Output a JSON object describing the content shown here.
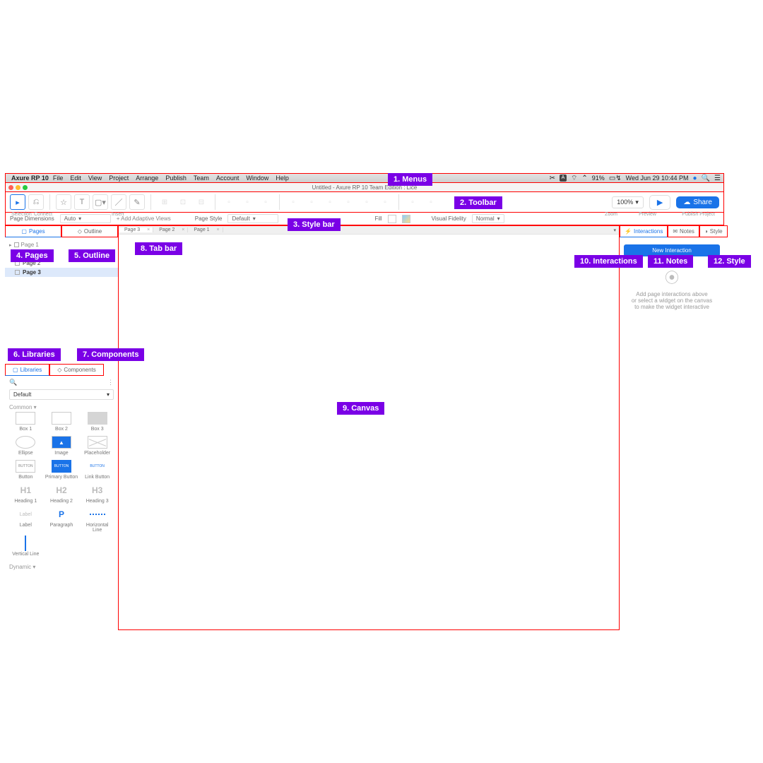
{
  "menubar": {
    "app": "Axure RP 10",
    "items": [
      "File",
      "Edit",
      "View",
      "Project",
      "Arrange",
      "Publish",
      "Team",
      "Account",
      "Window",
      "Help"
    ],
    "battery": "91%",
    "datetime": "Wed Jun 29  10:44 PM"
  },
  "titlebar": {
    "title": "Untitled - Axure RP 10 Team Edition : Lice"
  },
  "toolbar": {
    "selection_lbl": "Selection",
    "connect_lbl": "Connect",
    "insert_lbl": "Insert",
    "zoom_val": "100%",
    "zoom_lbl": "Zoom",
    "preview_lbl": "Preview",
    "share": "Share",
    "publish_lbl": "Publish Project"
  },
  "stylebar": {
    "dims_lbl": "Page Dimensions",
    "dims_val": "Auto",
    "adaptive": "+ Add Adaptive Views",
    "pagestyle_lbl": "Page Style",
    "pagestyle_val": "Default",
    "fill_lbl": "Fill",
    "visual_lbl": "Visual Fidelity",
    "visual_val": "Normal"
  },
  "left": {
    "pages_tab": "Pages",
    "outline_tab": "Outline",
    "pages_hdr": "Page 1",
    "pages": [
      "Page 1",
      "Page 2",
      "Page 3"
    ],
    "selected": "Page 3",
    "lib_tab": "Libraries",
    "comp_tab": "Components",
    "lib_select": "Default",
    "cat_common": "Common",
    "cat_dynamic": "Dynamic",
    "widgets": [
      {
        "n": "Box 1",
        "k": "box"
      },
      {
        "n": "Box 2",
        "k": "box"
      },
      {
        "n": "Box 3",
        "k": "filled"
      },
      {
        "n": "Ellipse",
        "k": "ellipse"
      },
      {
        "n": "Image",
        "k": "img"
      },
      {
        "n": "Placeholder",
        "k": "ph"
      },
      {
        "n": "Button",
        "k": "btn"
      },
      {
        "n": "Primary Button",
        "k": "pbtn"
      },
      {
        "n": "Link Button",
        "k": "lbtn"
      },
      {
        "n": "Heading 1",
        "k": "h",
        "t": "H1"
      },
      {
        "n": "Heading 2",
        "k": "h",
        "t": "H2"
      },
      {
        "n": "Heading 3",
        "k": "h",
        "t": "H3"
      },
      {
        "n": "Label",
        "k": "lbl",
        "t": "Label"
      },
      {
        "n": "Paragraph",
        "k": "para",
        "t": "P"
      },
      {
        "n": "Horizontal Line",
        "k": "hline"
      },
      {
        "n": "Vertical Line",
        "k": "vline"
      }
    ]
  },
  "doctabs": [
    "Page 3",
    "Page 2",
    "Page 1"
  ],
  "right": {
    "interactions": "Interactions",
    "notes": "Notes",
    "style": "Style",
    "new_int": "New Interaction",
    "hint1": "Add page interactions above",
    "hint2": "or select a widget on the canvas",
    "hint3": "to make the widget interactive"
  },
  "annotations": {
    "a1": "1. Menus",
    "a2": "2. Toolbar",
    "a3": "3. Style bar",
    "a4": "4. Pages",
    "a5": "5. Outline",
    "a6": "6. Libraries",
    "a7": "7. Components",
    "a8": "8. Tab bar",
    "a9": "9. Canvas",
    "a10": "10. Interactions",
    "a11": "11. Notes",
    "a12": "12. Style"
  }
}
